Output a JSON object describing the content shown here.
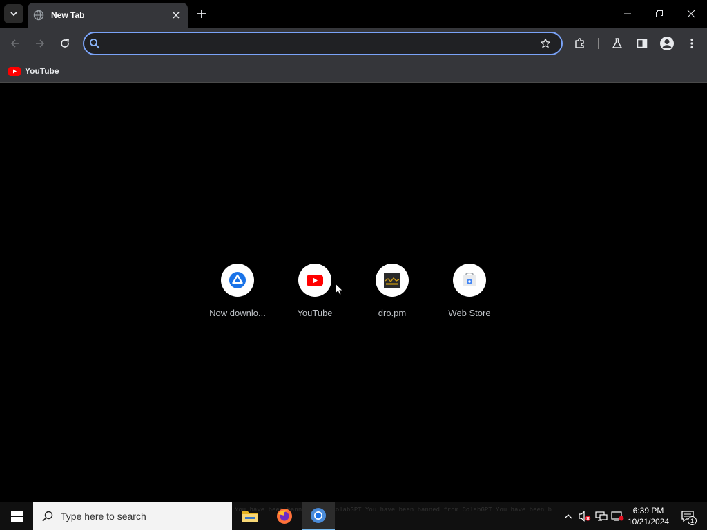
{
  "browser": {
    "tab": {
      "title": "New Tab",
      "favicon": "globe-icon"
    },
    "window_controls": [
      "minimize-icon",
      "restore-icon",
      "close-icon"
    ]
  },
  "toolbar": {
    "omnibox": {
      "value": "",
      "placeholder": ""
    }
  },
  "bookmarks": [
    {
      "label": "YouTube",
      "icon": "youtube-icon"
    }
  ],
  "shortcuts": [
    {
      "label": "Now downlo...",
      "icon": "drive-icon"
    },
    {
      "label": "YouTube",
      "icon": "youtube-icon"
    },
    {
      "label": "dro.pm",
      "icon": "dropm-icon"
    },
    {
      "label": "Web Store",
      "icon": "webstore-icon"
    }
  ],
  "taskbar": {
    "search_placeholder": "Type here to search",
    "background_text": "You have been banned from ColabGPT   You have been banned from ColabGPT   You have been banned from ColabGPT   You have been banned from ColabGPT",
    "time": "6:39 PM",
    "date": "10/21/2024",
    "notification_count": "1"
  },
  "colors": {
    "tab_bg": "#35363a",
    "omnibox_border": "#7aa3f8",
    "youtube_red": "#ff0000",
    "taskbar_bg": "#101010"
  }
}
